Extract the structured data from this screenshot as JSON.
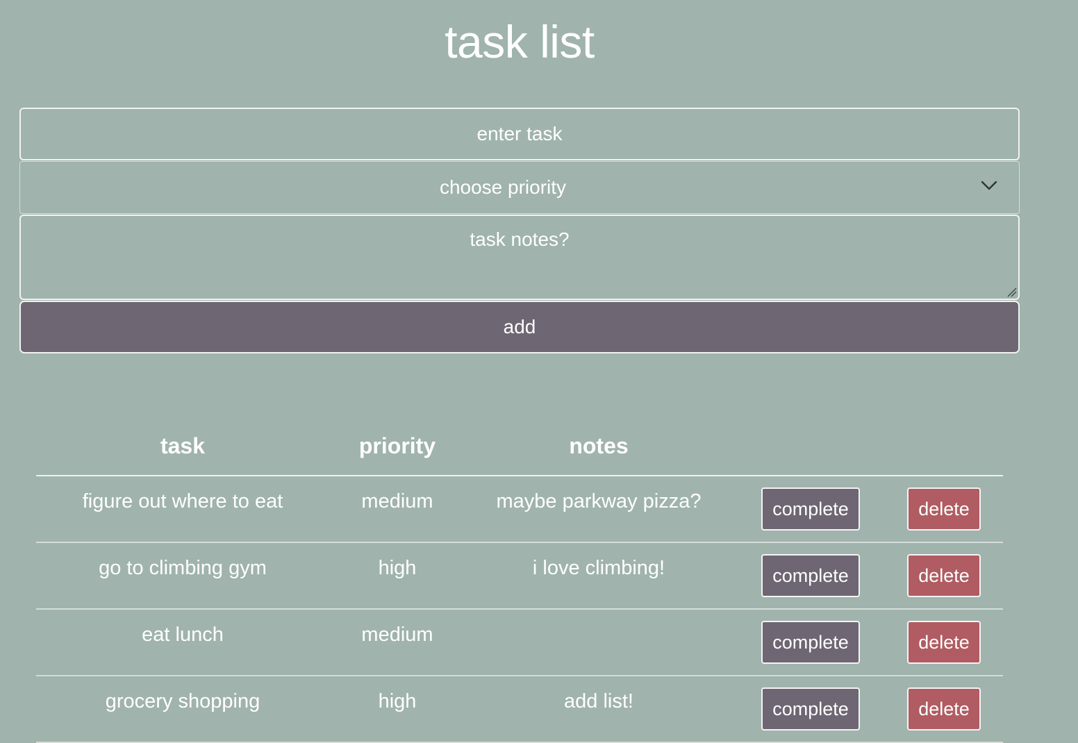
{
  "title": "task list",
  "form": {
    "task_placeholder": "enter task",
    "priority_label": "choose priority",
    "notes_placeholder": "task notes?",
    "add_label": "add"
  },
  "table": {
    "headers": {
      "task": "task",
      "priority": "priority",
      "notes": "notes"
    },
    "rows": [
      {
        "task": "figure out where to eat",
        "priority": "medium",
        "notes": "maybe parkway pizza?",
        "complete": "complete",
        "delete": "delete"
      },
      {
        "task": "go to climbing gym",
        "priority": "high",
        "notes": "i love climbing!",
        "complete": "complete",
        "delete": "delete"
      },
      {
        "task": "eat lunch",
        "priority": "medium",
        "notes": "",
        "complete": "complete",
        "delete": "delete"
      },
      {
        "task": "grocery shopping",
        "priority": "high",
        "notes": "add list!",
        "complete": "complete",
        "delete": "delete"
      }
    ]
  },
  "colors": {
    "background": "#a0b3ad",
    "button_primary": "#6e6672",
    "button_delete": "#b05c62",
    "text": "#ffffff"
  },
  "icons": {
    "priority_dropdown": "chevron-down-icon",
    "notes_resize": "resize-grip-icon"
  }
}
